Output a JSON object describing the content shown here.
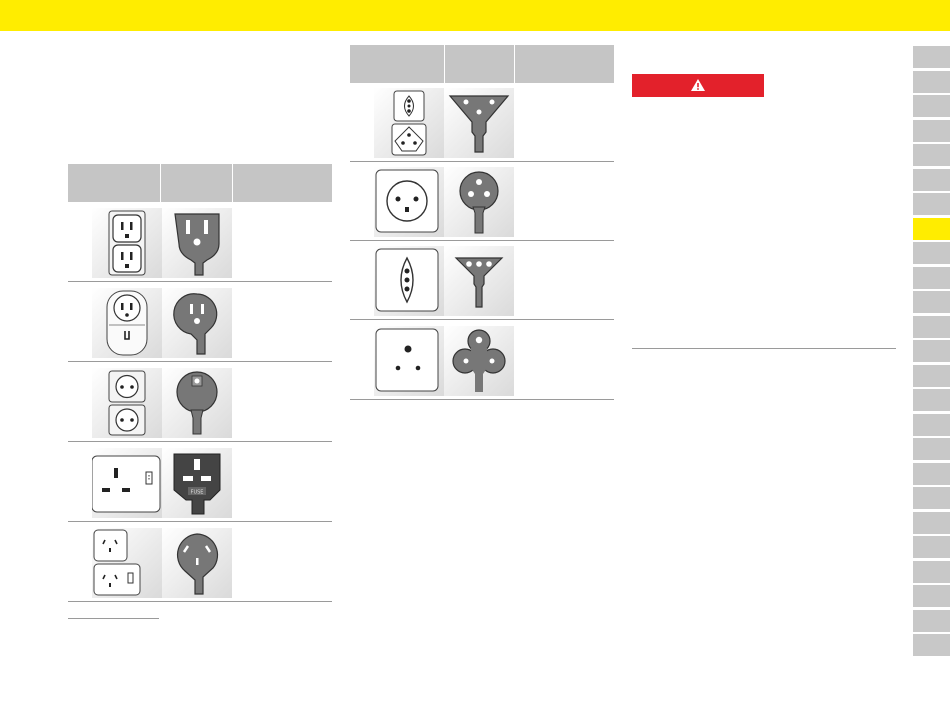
{
  "colors": {
    "header": "#ffed00",
    "warning": "#e3212b",
    "table_header": "#c5c5c5",
    "tab": "#c8c8c8",
    "tab_active": "#ffed00"
  },
  "warning": {
    "icon": "warning-triangle-icon"
  },
  "left_table": {
    "rows": [
      {
        "socket": "socket-type-b-double-icon",
        "plug": "plug-type-b-icon"
      },
      {
        "socket": "socket-type-b-switched-icon",
        "plug": "plug-type-b-round-icon"
      },
      {
        "socket": "socket-schuko-double-icon",
        "plug": "plug-schuko-icon"
      },
      {
        "socket": "socket-type-g-icon",
        "plug": "plug-type-g-fused-icon"
      },
      {
        "socket": "socket-type-i-double-icon",
        "plug": "plug-type-i-icon"
      }
    ]
  },
  "right_table": {
    "rows": [
      {
        "socket": "socket-type-j-double-icon",
        "plug": "plug-type-j-icon"
      },
      {
        "socket": "socket-type-k-icon",
        "plug": "plug-type-k-icon"
      },
      {
        "socket": "socket-type-l-icon",
        "plug": "plug-type-l-icon"
      },
      {
        "socket": "socket-type-d-icon",
        "plug": "plug-type-d-icon"
      }
    ]
  },
  "side_tabs": {
    "count": 25,
    "active_index": 7
  }
}
